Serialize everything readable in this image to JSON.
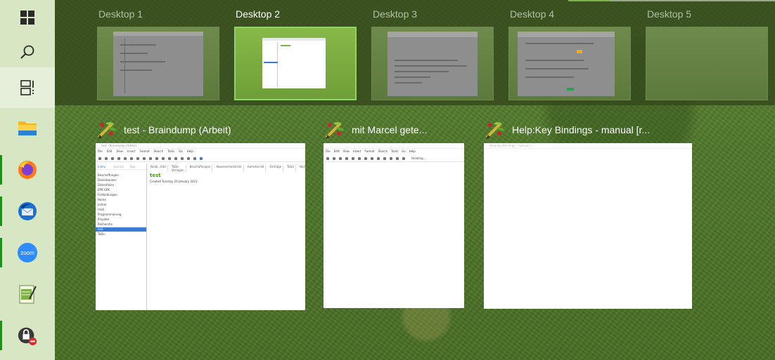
{
  "taskbar": {
    "items": [
      {
        "name": "start-button",
        "icon": "windows-logo-icon"
      },
      {
        "name": "search-button",
        "icon": "search-icon"
      },
      {
        "name": "task-view-button",
        "icon": "task-view-icon"
      },
      {
        "name": "file-explorer-button",
        "icon": "folder-icon"
      },
      {
        "name": "firefox-button",
        "icon": "firefox-icon"
      },
      {
        "name": "thunderbird-button",
        "icon": "thunderbird-icon"
      },
      {
        "name": "zoom-button",
        "icon": "zoom-icon",
        "label": "zoom"
      },
      {
        "name": "notepad-button",
        "icon": "notepad-icon"
      },
      {
        "name": "vpn-button",
        "icon": "lock-icon"
      }
    ]
  },
  "desktops": [
    {
      "label": "Desktop 1",
      "current": false
    },
    {
      "label": "Desktop 2",
      "current": true
    },
    {
      "label": "Desktop 3",
      "current": false
    },
    {
      "label": "Desktop 4",
      "current": false
    },
    {
      "label": "Desktop 5",
      "current": false
    }
  ],
  "windows": [
    {
      "title": "test - Braindump (Arbeit)",
      "app_icon": "zim-icon",
      "thumb": {
        "menu": [
          "File",
          "Edit",
          "View",
          "Insert",
          "Format",
          "Search",
          "Tools",
          "Go",
          "Help"
        ],
        "side_tabs": [
          "Index",
          "Journal",
          "Tags"
        ],
        "tabs": [
          "Noob...Edit",
          "ToDo Vorlagen",
          "Beschaffungen",
          "Abwesenheitsliste",
          "Hamsterrad",
          "Einträge",
          "ToDo",
          "Home",
          "test"
        ],
        "side_items": [
          "Beschaffungen",
          "Datenbanken",
          "Datenfolien",
          "EPK GPK",
          "Fortbildungen",
          "Home",
          "Lehrer",
          "misk",
          "Programmierung",
          "Projekte",
          "Recherche",
          "test",
          "ToDo"
        ],
        "page_title": "test",
        "page_meta": "Created Tuesday 24 January 2023"
      }
    },
    {
      "title": "mit Marcel gete...",
      "app_icon": "zim-icon",
      "thumb": {
        "menu": [
          "File",
          "Edit",
          "View",
          "Insert",
          "Format",
          "Search",
          "Tools",
          "Go",
          "Help"
        ],
        "heading": "Heading..."
      }
    },
    {
      "title": "Help:Key Bindings - manual [r...",
      "app_icon": "zim-icon",
      "thumb": {}
    }
  ],
  "colors": {
    "taskbar_bg": "#d7e6c3",
    "indicator": "#1e8f1e",
    "strip_bg": "rgba(52,72,28,0.82)",
    "selected_border": "#8fd46a"
  }
}
